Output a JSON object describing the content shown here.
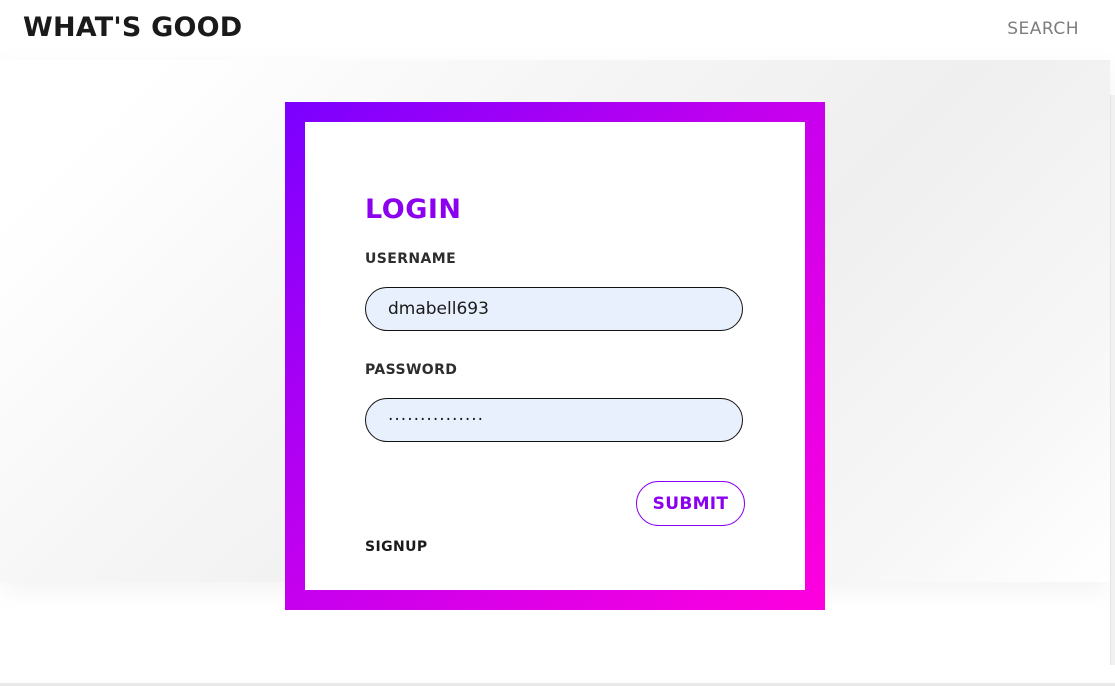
{
  "header": {
    "brand": "WHAT'S GOOD",
    "search_label": "SEARCH"
  },
  "login": {
    "title": "LOGIN",
    "username_label": "USERNAME",
    "username_value": "dmabell693",
    "password_label": "PASSWORD",
    "password_value": "···············",
    "submit_label": "SUBMIT",
    "signup_label": "SIGNUP"
  },
  "colors": {
    "accent": "#8b00ef",
    "gradient_start": "#7a00ff",
    "gradient_end": "#ff00de",
    "input_bg": "#e8f0fe"
  }
}
